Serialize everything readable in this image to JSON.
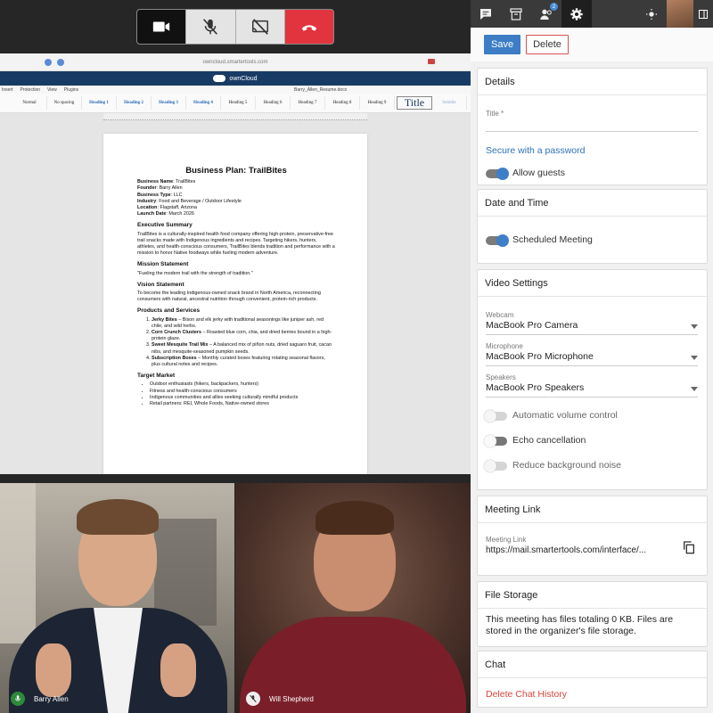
{
  "call_controls": {
    "icons": [
      "video-camera-icon",
      "microphone-muted-icon",
      "screen-share-off-icon",
      "hang-up-icon"
    ]
  },
  "shared_screen": {
    "url": "owncloud.smartertools.com",
    "brand": "ownCloud",
    "menu": [
      "Insert",
      "Protection",
      "View",
      "Plugins"
    ],
    "doc_name": "Barry_Allen_Resume.docx",
    "styles": [
      "Normal",
      "No spacing",
      "Heading 1",
      "Heading 2",
      "Heading 3",
      "Heading 4",
      "Heading 5",
      "Heading 6",
      "Heading 7",
      "Heading 8",
      "Heading 9",
      "Title",
      "Subtitle"
    ],
    "document": {
      "title": "Business Plan: TrailBites",
      "fields": [
        {
          "k": "Business Name",
          "v": "TrailBites"
        },
        {
          "k": "Founder",
          "v": "Barry Allen"
        },
        {
          "k": "Business Type",
          "v": "LLC"
        },
        {
          "k": "Industry",
          "v": "Food and Beverage / Outdoor Lifestyle"
        },
        {
          "k": "Location",
          "v": "Flagstaff, Arizona"
        },
        {
          "k": "Launch Date",
          "v": "March 2026"
        }
      ],
      "exec_heading": "Executive Summary",
      "exec_text": "TrailBites is a culturally-inspired health food company offering high-protein, preservative-free trail snacks made with Indigenous ingredients and recipes. Targeting hikers, hunters, athletes, and health-conscious consumers, TrailBites blends tradition and performance with a mission to honor Native foodways while fueling modern adventure.",
      "mission_heading": "Mission Statement",
      "mission_text": "\"Fueling the modern trail with the strength of tradition.\"",
      "vision_heading": "Vision Statement",
      "vision_text": "To become the leading Indigenous-owned snack brand in North America, reconnecting consumers with natural, ancestral nutrition through convenient, protein-rich products.",
      "products_heading": "Products and Services",
      "products": [
        {
          "name": "Jerky Bites",
          "desc": " – Bison and elk jerky with traditional seasonings like juniper ash, red chile, and wild herbs."
        },
        {
          "name": "Corn Crunch Clusters",
          "desc": " – Roasted blue corn, chia, and dried berries bound in a high-protein glaze."
        },
        {
          "name": "Sweet Mesquite Trail Mix",
          "desc": " – A balanced mix of piñon nuts, dried saguaro fruit, cacao nibs, and mesquite-seasoned pumpkin seeds."
        },
        {
          "name": "Subscription Boxes",
          "desc": " – Monthly curated boxes featuring rotating seasonal flavors, plus cultural notes and recipes."
        }
      ],
      "market_heading": "Target Market",
      "market": [
        "Outdoor enthusiasts (hikers, backpackers, hunters)",
        "Fitness and health-conscious consumers",
        "Indigenous communities and allies seeking culturally mindful products",
        "Retail partners: REI, Whole Foods, Native-owned stores"
      ]
    }
  },
  "participants": [
    {
      "name": "Barry Allen",
      "mic": "on"
    },
    {
      "name": "Will Shepherd",
      "mic": "muted"
    }
  ],
  "topbar": {
    "icons": [
      "chat-icon",
      "archive-icon",
      "participants-icon",
      "settings-icon",
      "brightness-icon",
      "sidebar-toggle-icon"
    ],
    "participants_badge": "2"
  },
  "actions": {
    "save": "Save",
    "delete": "Delete"
  },
  "details": {
    "header": "Details",
    "title_label": "Title *",
    "title_value": "",
    "password_link": "Secure with a password",
    "allow_guests": "Allow guests"
  },
  "date_time": {
    "header": "Date and Time",
    "scheduled": "Scheduled Meeting"
  },
  "video_settings": {
    "header": "Video Settings",
    "webcam_label": "Webcam",
    "webcam_value": "MacBook Pro Camera",
    "microphone_label": "Microphone",
    "microphone_value": "MacBook Pro Microphone",
    "speakers_label": "Speakers",
    "speakers_value": "MacBook Pro Speakers",
    "auto_volume": "Automatic volume control",
    "echo": "Echo cancellation",
    "noise": "Reduce background noise"
  },
  "meeting_link": {
    "header": "Meeting Link",
    "label": "Meeting Link",
    "value": "https://mail.smartertools.com/interface/..."
  },
  "file_storage": {
    "header": "File Storage",
    "text": "This meeting has files totaling 0 KB. Files are stored in the organizer's file storage."
  },
  "chat": {
    "header": "Chat",
    "delete": "Delete Chat History"
  },
  "colors": {
    "accent": "#3c7dc6",
    "danger": "#d9443a",
    "hangup": "#e1343f"
  }
}
